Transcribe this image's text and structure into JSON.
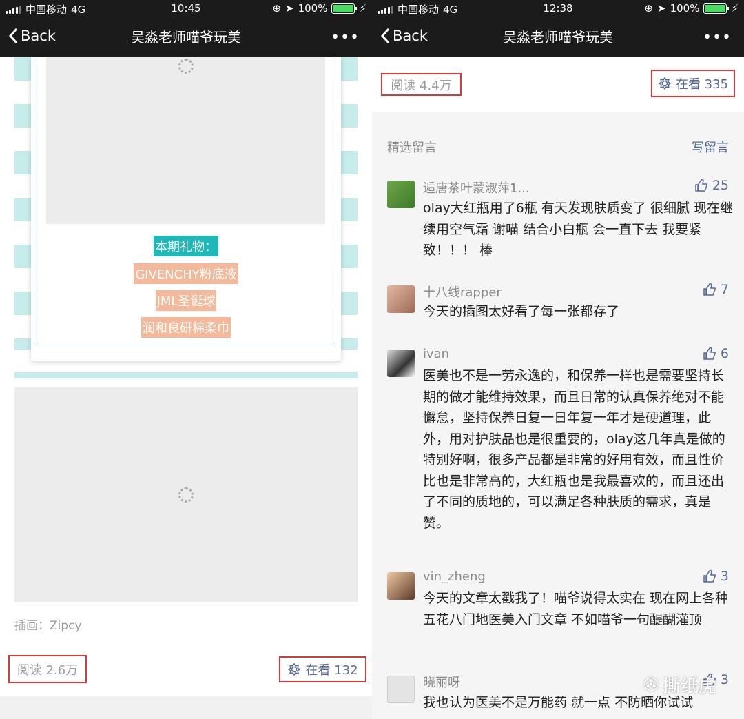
{
  "status_left": {
    "carrier": "中国移动",
    "network": "4G",
    "time": "10:45",
    "battery": "100%"
  },
  "status_right": {
    "carrier": "中国移动",
    "network": "4G",
    "time": "12:38",
    "battery": "100%"
  },
  "nav": {
    "back": "Back",
    "title": "吴淼老师喵爷玩美",
    "more": "•••"
  },
  "left": {
    "gift_title": "本期礼物：",
    "gifts": [
      "GIVENCHY粉底液",
      "JML圣诞球",
      "润和良研棉柔巾"
    ],
    "caption": "插画：Zipcy",
    "read": "阅读 2.6万",
    "watching": "在看 132"
  },
  "right": {
    "read": "阅读 4.4万",
    "watching": "在看 335",
    "section": "精选留言",
    "write": "写留言",
    "comments": [
      {
        "name": "逅唐茶叶蒙淑萍1...",
        "likes": "25",
        "text": "olay大红瓶用了6瓶 有天发现肤质变了 很细腻 现在继续用空气霜  谢喵 结合小白瓶 会一直下去 我要紧致！！！ 棒"
      },
      {
        "name": "十八线rapper",
        "likes": "7",
        "text": "今天的插图太好看了每一张都存了"
      },
      {
        "name": "ivan",
        "likes": "6",
        "text": "医美也不是一劳永逸的，和保养一样也是需要坚持长期的做才能维持效果，而且日常的认真保养绝对不能懈怠，坚持保养日复一日年复一年才是硬道理，此外，用对护肤品也是很重要的，olay这几年真是做的特别好啊，很多产品都是非常的好用有效，而且性价比也是非常高的，大红瓶也是我最喜欢的，而且还出了不同的质地的，可以满足各种肤质的需求，真是赞。"
      },
      {
        "name": "vin_zheng",
        "likes": "3",
        "text": "今天的文章太戳我了！喵爷说得太实在 现在网上各种五花八门地医美入门文章 不如喵爷一句醍醐灌顶"
      },
      {
        "name": "晓丽呀",
        "likes": "3",
        "text": "我也认为医美不是万能药 就一点 不防晒你试试"
      }
    ],
    "watermark": "撕纸虎"
  },
  "colors": {
    "accent": "#576b95",
    "teal": "#1fb8b8",
    "peach": "#f4b99a",
    "red": "#d43c3c"
  }
}
